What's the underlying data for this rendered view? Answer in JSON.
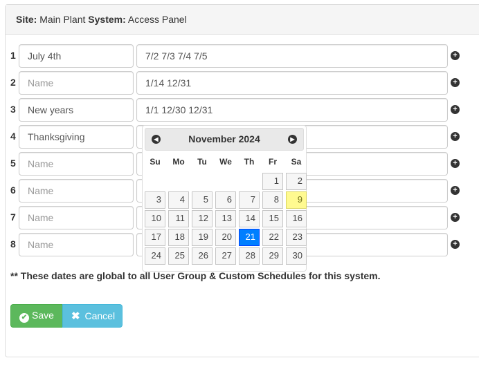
{
  "header": {
    "site_label": "Site:",
    "site_value": "Main Plant",
    "system_label": "System:",
    "system_value": "Access Panel"
  },
  "rows": [
    {
      "num": "1",
      "name": "July 4th",
      "name_placeholder": "Name",
      "dates": "7/2 7/3 7/4 7/5"
    },
    {
      "num": "2",
      "name": "",
      "name_placeholder": "Name",
      "dates": "1/14 12/31"
    },
    {
      "num": "3",
      "name": "New years",
      "name_placeholder": "Name",
      "dates": "1/1 12/30 12/31"
    },
    {
      "num": "4",
      "name": "Thanksgiving",
      "name_placeholder": "Name",
      "dates": ""
    },
    {
      "num": "5",
      "name": "",
      "name_placeholder": "Name",
      "dates": ""
    },
    {
      "num": "6",
      "name": "",
      "name_placeholder": "Name",
      "dates": ""
    },
    {
      "num": "7",
      "name": "",
      "name_placeholder": "Name",
      "dates": ""
    },
    {
      "num": "8",
      "name": "",
      "name_placeholder": "Name",
      "dates": ""
    }
  ],
  "add_icon": "plus-circle-icon",
  "note": "** These dates are global to all User Group & Custom Schedules for this system.",
  "buttons": {
    "save_label": "Save",
    "cancel_label": "Cancel",
    "save_icon": "check-circle-icon",
    "cancel_icon": "close-icon"
  },
  "datepicker": {
    "title": "November 2024",
    "weekdays": [
      "Su",
      "Mo",
      "Tu",
      "We",
      "Th",
      "Fr",
      "Sa"
    ],
    "weeks": [
      [
        "",
        "",
        "",
        "",
        "",
        "1",
        "2"
      ],
      [
        "3",
        "4",
        "5",
        "6",
        "7",
        "8",
        "9"
      ],
      [
        "10",
        "11",
        "12",
        "13",
        "14",
        "15",
        "16"
      ],
      [
        "17",
        "18",
        "19",
        "20",
        "21",
        "22",
        "23"
      ],
      [
        "24",
        "25",
        "26",
        "27",
        "28",
        "29",
        "30"
      ]
    ],
    "today": "9",
    "selected": "21",
    "colors": {
      "today_bg": "#fffa90",
      "selected_bg": "#007fff"
    }
  },
  "colors": {
    "save": "#5cb85c",
    "cancel": "#5bc0de"
  }
}
